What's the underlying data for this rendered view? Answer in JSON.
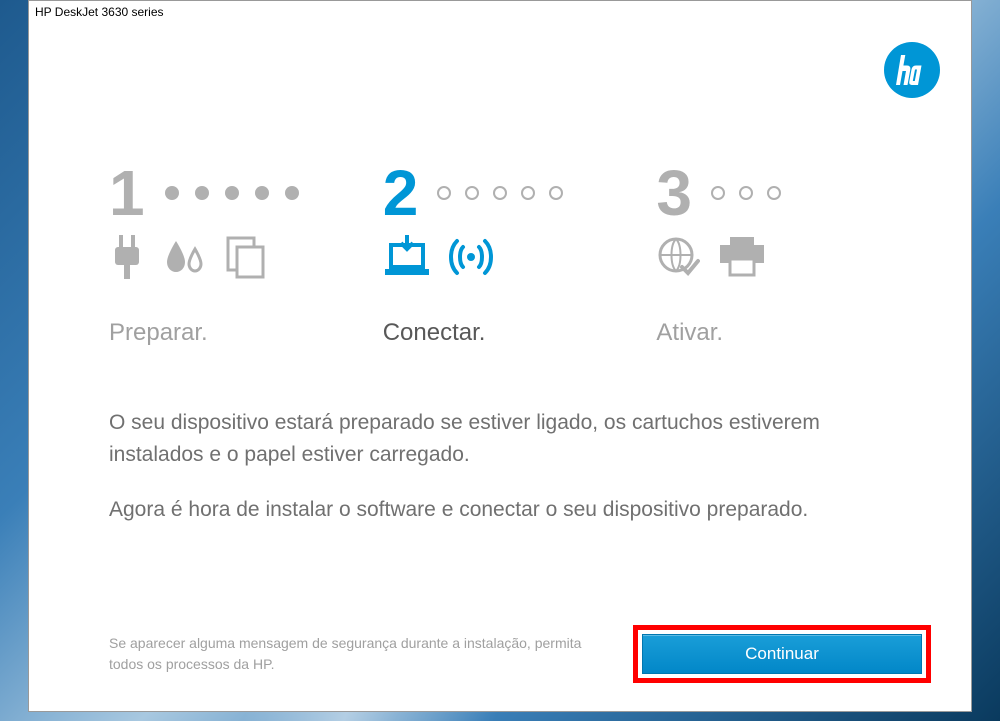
{
  "window": {
    "title": "HP DeskJet 3630 series"
  },
  "steps": {
    "s1": {
      "num": "1",
      "label": "Preparar."
    },
    "s2": {
      "num": "2",
      "label": "Conectar."
    },
    "s3": {
      "num": "3",
      "label": "Ativar."
    }
  },
  "body": {
    "p1": "O seu dispositivo estará preparado se estiver ligado, os cartuchos estiverem instalados e o papel estiver carregado.",
    "p2": "Agora é hora de instalar o software e conectar o seu dispositivo preparado."
  },
  "footer": {
    "note": "Se aparecer alguma mensagem de segurança durante a instalação, permita todos os processos da HP.",
    "button": "Continuar"
  },
  "colors": {
    "accent": "#0096d6",
    "muted": "#b0b0b0"
  }
}
